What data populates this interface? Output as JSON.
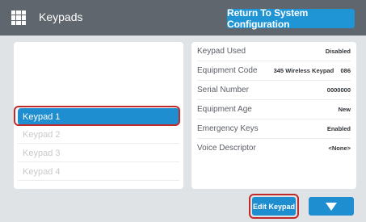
{
  "header": {
    "title": "Keypads",
    "return_label": "Return To System Configuration"
  },
  "keypads": {
    "items": [
      {
        "label": "Keypad 1"
      },
      {
        "label": "Keypad 2"
      },
      {
        "label": "Keypad 3"
      },
      {
        "label": "Keypad 4"
      }
    ],
    "selected": "Keypad 1"
  },
  "properties": [
    {
      "label": "Keypad Used",
      "value": "Disabled"
    },
    {
      "label": "Equipment Code",
      "value": "345 Wireless Keypad    086"
    },
    {
      "label": "Serial Number",
      "value": "0000000"
    },
    {
      "label": "Equipment Age",
      "value": "New"
    },
    {
      "label": "Emergency Keys",
      "value": "Enabled"
    },
    {
      "label": "Voice Descriptor",
      "value": "<None>"
    }
  ],
  "footer": {
    "edit_label": "Edit Keypad",
    "down_icon": "chevron-down-icon"
  },
  "colors": {
    "accent": "#1f8ed0",
    "highlight": "#c02a2a",
    "header": "#60666d"
  }
}
